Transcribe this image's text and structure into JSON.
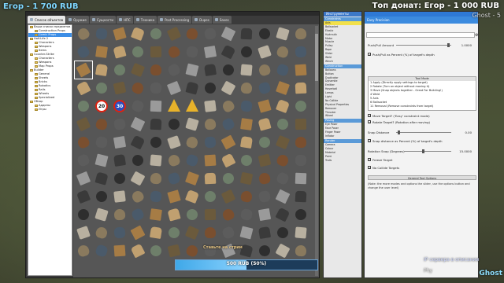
{
  "hud": {
    "donator_left": "Егор - 1 700 RUB",
    "donator_right_label": "Топ донат:",
    "donator_right": "Егор - 1 000 RUB",
    "username": "Ghost - 5",
    "notice": "IP сервера в описании",
    "player": "Phy",
    "server_text": "Ghost"
  },
  "spawnmenu": {
    "tabs": [
      {
        "label": "Список объектов",
        "active": true
      },
      {
        "label": "Оружие"
      },
      {
        "label": "Сущности"
      },
      {
        "label": "НПС"
      },
      {
        "label": "Техника"
      },
      {
        "label": "Post Processing"
      },
      {
        "label": "Dupes"
      },
      {
        "label": "Saves"
      }
    ],
    "tree": [
      {
        "label": "Ваши списки предметов",
        "indent": 0
      },
      {
        "label": "Construction Props",
        "indent": 1
      },
      {
        "label": "Comic Props",
        "indent": 1,
        "selected": true
      },
      {
        "label": "Half-Life 2",
        "indent": 0
      },
      {
        "label": "Characters",
        "indent": 1
      },
      {
        "label": "Weapons",
        "indent": 1
      },
      {
        "label": "Items",
        "indent": 1
      },
      {
        "label": "Counter-Strike",
        "indent": 0
      },
      {
        "label": "Characters",
        "indent": 1
      },
      {
        "label": "Weapons",
        "indent": 1
      },
      {
        "label": "Map Props",
        "indent": 1
      },
      {
        "label": "Builder",
        "indent": 0
      },
      {
        "label": "General",
        "indent": 1
      },
      {
        "label": "Sheets",
        "indent": 1
      },
      {
        "label": "Bricks",
        "indent": 1
      },
      {
        "label": "Robotics",
        "indent": 1
      },
      {
        "label": "Rails",
        "indent": 1
      },
      {
        "label": "Wheels",
        "indent": 1
      },
      {
        "label": "Specialized",
        "indent": 1
      },
      {
        "label": "Обзор",
        "indent": 0
      },
      {
        "label": "Аддоны",
        "indent": 1
      },
      {
        "label": "Игры",
        "indent": 1
      }
    ],
    "scene_text": "Ставьте на стрим"
  },
  "tools": {
    "tab_label": "Инструменты",
    "categories": [
      {
        "label": "Constraints",
        "items": [
          "Axis",
          "Ballsocket",
          "Elastic",
          "Hydraulic",
          "Motor",
          "Muscle",
          "Pulley",
          "Rope",
          "Slider",
          "Weld",
          "Winch"
        ]
      },
      {
        "label": "Construction",
        "items": [
          "Balloons",
          "Button",
          "Duplicator",
          "Dynamite",
          "Emitter",
          "Hoverball",
          "Lamps",
          "Light",
          "No Collide",
          "Physical Properties",
          "Remover",
          "Thruster",
          "Wheel"
        ]
      },
      {
        "label": "Posing",
        "items": [
          "Eye Poser",
          "Face Poser",
          "Finger Poser",
          "Inflator"
        ]
      },
      {
        "label": "Render",
        "items": [
          "Camera",
          "Colour",
          "Material",
          "Paint",
          "Trails"
        ]
      }
    ],
    "selected": "Easy Precision"
  },
  "options": {
    "header": "Easy Precision",
    "push_pull_label": "Push/Pull Amount",
    "push_pull_value": "1.0000",
    "pushpull_percent_label": "Push/Pull as Percent (%) of target's depth",
    "tool_mode_title": "Tool Mode",
    "modes": [
      "1 Apply (Directly apply settings to target)",
      "2 Rotate (Turn an object without moving it)",
      "3 Move (Snap objects together - Great For Building!)",
      "4 Weld",
      "5 Axis",
      "6 Ballsocket",
      "11 Removal (Remove constraints from target)"
    ],
    "move_target": "Move Target? ('Easy' constraint mode)",
    "rotate_target": "Rotate Target? (Rotation after moving)",
    "snap_distance_label": "Snap Distance",
    "snap_distance_value": "0.00",
    "snap_percent_label": "Snap distance as Percent (%) of target's depth",
    "rotation_snap_label": "Rotation Snap (Degrees)",
    "rotation_snap_value": "15.0000",
    "freeze_target": "Freeze Target",
    "nocollide_targets": "No Collide Targets",
    "general_options": "General Tool Options",
    "help_line1": "(Note: the more modes and options the slider, use the options button and",
    "help_line2": "change the user level)"
  },
  "progress": {
    "label": "500 RUB (50%)",
    "fraction": 0.5
  }
}
